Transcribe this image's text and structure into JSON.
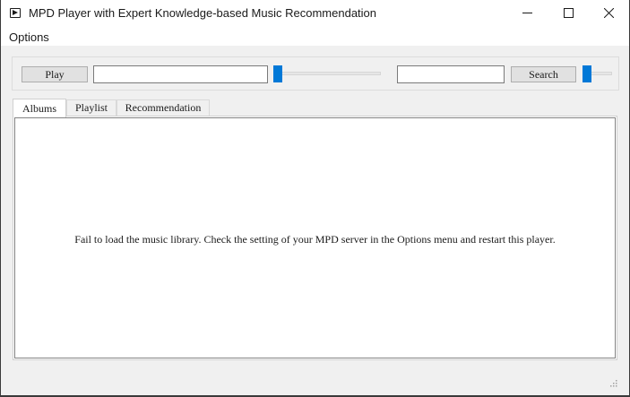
{
  "window": {
    "title": "MPD Player with Expert Knowledge-based Music Recommendation"
  },
  "menu": {
    "options_label": "Options"
  },
  "toolbar": {
    "play_label": "Play",
    "main_input_value": "",
    "search_input_value": "",
    "search_label": "Search",
    "position_slider_fraction": 0.0,
    "volume_slider_fraction": 0.0
  },
  "tabs": [
    {
      "label": "Albums",
      "selected": true
    },
    {
      "label": "Playlist",
      "selected": false
    },
    {
      "label": "Recommendation",
      "selected": false
    }
  ],
  "panel": {
    "message": "Fail to load the music library. Check the setting of your MPD server in the Options menu and restart this player."
  },
  "colors": {
    "accent": "#0078d7",
    "window_bg": "#f0f0f0"
  },
  "icons": {
    "app": "play-icon",
    "minimize": "minimize-icon",
    "maximize": "maximize-icon",
    "close": "close-icon",
    "grip": "resize-grip-icon"
  }
}
